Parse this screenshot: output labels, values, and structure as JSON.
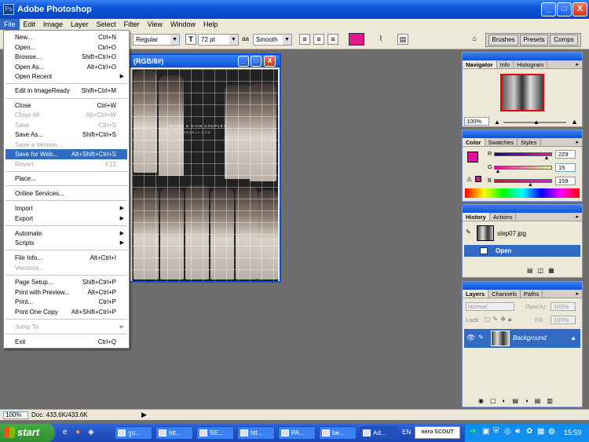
{
  "app": {
    "title": "Adobe Photoshop",
    "icon": "ps-app-icon"
  },
  "window_buttons": {
    "minimize": "_",
    "maximize": "□",
    "close": "X"
  },
  "menubar": [
    "File",
    "Edit",
    "Image",
    "Layer",
    "Select",
    "Filter",
    "View",
    "Window",
    "Help"
  ],
  "options": {
    "font_style": "Regular",
    "font_size": "72 pt",
    "antialias_label": "a",
    "antialias": "Smooth",
    "color_swatch": "#e0198f"
  },
  "wells": [
    "Brushes",
    "Presets",
    "Comps"
  ],
  "document": {
    "title": "(RGB/8#)",
    "overlay_line1": "NICKY & GIAN COUPLET",
    "overlay_line2": "ZABBONLY.COM"
  },
  "file_menu": [
    {
      "label": "New...",
      "shortcut": "Ctrl+N"
    },
    {
      "label": "Open...",
      "shortcut": "Ctrl+O"
    },
    {
      "label": "Browse...",
      "shortcut": "Shift+Ctrl+O"
    },
    {
      "label": "Open As...",
      "shortcut": "Alt+Ctrl+O"
    },
    {
      "label": "Open Recent",
      "shortcut": "▶"
    },
    {
      "label": "Edit in ImageReady",
      "shortcut": "Shift+Ctrl+M"
    },
    {
      "label": "Close",
      "shortcut": "Ctrl+W"
    },
    {
      "label": "Close All",
      "shortcut": "Alt+Ctrl+W"
    },
    {
      "label": "Save",
      "shortcut": "Ctrl+S"
    },
    {
      "label": "Save As...",
      "shortcut": "Shift+Ctrl+S"
    },
    {
      "label": "Save a Version...",
      "shortcut": ""
    },
    {
      "label": "Save for Web...",
      "shortcut": "Alt+Shift+Ctrl+S"
    },
    {
      "label": "Revert",
      "shortcut": "F12"
    },
    {
      "label": "Place...",
      "shortcut": ""
    },
    {
      "label": "Online Services...",
      "shortcut": ""
    },
    {
      "label": "Import",
      "shortcut": "▶"
    },
    {
      "label": "Export",
      "shortcut": "▶"
    },
    {
      "label": "Automate",
      "shortcut": "▶"
    },
    {
      "label": "Scripts",
      "shortcut": "▶"
    },
    {
      "label": "File Info...",
      "shortcut": "Alt+Ctrl+I"
    },
    {
      "label": "Versions...",
      "shortcut": ""
    },
    {
      "label": "Page Setup...",
      "shortcut": "Shift+Ctrl+P"
    },
    {
      "label": "Print with Preview...",
      "shortcut": "Alt+Ctrl+P"
    },
    {
      "label": "Print...",
      "shortcut": "Ctrl+P"
    },
    {
      "label": "Print One Copy",
      "shortcut": "Alt+Shift+Ctrl+P"
    },
    {
      "label": "Jump To",
      "shortcut": "▶"
    },
    {
      "label": "Exit",
      "shortcut": "Ctrl+Q"
    }
  ],
  "navigator": {
    "tabs": [
      "Navigator",
      "Info",
      "Histogram"
    ],
    "zoom": "100%"
  },
  "color": {
    "tabs": [
      "Color",
      "Swatches",
      "Styles"
    ],
    "r_label": "R",
    "g_label": "G",
    "b_label": "B",
    "r": "229",
    "g": "15",
    "b": "159",
    "fg": "#e50f9f",
    "r_level": 0.9,
    "g_level": 0.06,
    "b_level": 0.62
  },
  "history": {
    "tabs": [
      "History",
      "Actions"
    ],
    "snapshot": "step07.jpg",
    "state": "Open"
  },
  "layers": {
    "tabs": [
      "Layers",
      "Channels",
      "Paths"
    ],
    "blend": "Normal",
    "opacity_label": "Opacity:",
    "opacity": "100%",
    "lock_label": "Lock:",
    "fill_label": "Fill:",
    "fill": "100%",
    "layer_name": "Background"
  },
  "status": {
    "zoom": "100%",
    "doc": "Doc: 433.6K/433.6K"
  },
  "taskbar": {
    "start": "start",
    "tasks": [
      "รูป...",
      "htt...",
      "SE...",
      "htt...",
      "PA...",
      "be...",
      "Ad..."
    ],
    "lang": "EN",
    "nero": "nero SCOUT",
    "time": "15:59"
  }
}
